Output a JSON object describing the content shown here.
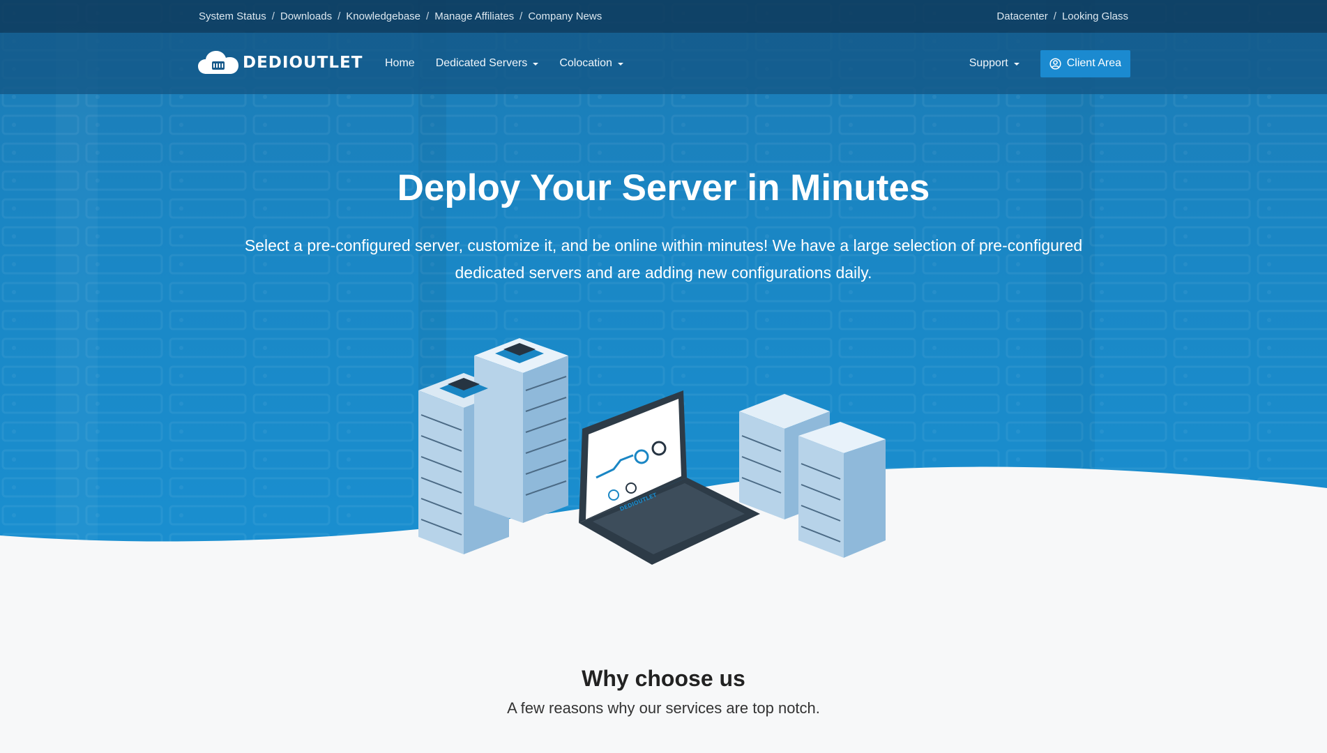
{
  "topbar": {
    "left_links": [
      "System Status",
      "Downloads",
      "Knowledgebase",
      "Manage Affiliates",
      "Company News"
    ],
    "right_links": [
      "Datacenter",
      "Looking Glass"
    ],
    "separator": "/"
  },
  "navbar": {
    "brand": "DEDIOUTLET",
    "links": [
      {
        "label": "Home",
        "dropdown": false
      },
      {
        "label": "Dedicated Servers",
        "dropdown": true
      },
      {
        "label": "Colocation",
        "dropdown": true
      }
    ],
    "support_label": "Support",
    "client_area_label": "Client Area"
  },
  "hero": {
    "title_bold": "Deploy Your Server",
    "title_light": "in Minutes",
    "subtitle": "Select a pre-configured server, customize it, and be online within minutes! We have a large selection of pre-configured dedicated servers and are adding new configurations daily.",
    "illustration_brand": "DEDIOUTLET"
  },
  "why": {
    "title": "Why choose us",
    "subtitle": "A few reasons why our services are top notch."
  },
  "colors": {
    "hero_blue": "#1a86c4",
    "topbar_dark": "#0e3a5c",
    "button_blue": "#1b8ad0",
    "page_bg": "#f7f8f9"
  },
  "icons": {
    "logo": "cloud-server-icon",
    "client_area": "user-circle-icon",
    "dropdown": "caret-down-icon"
  }
}
